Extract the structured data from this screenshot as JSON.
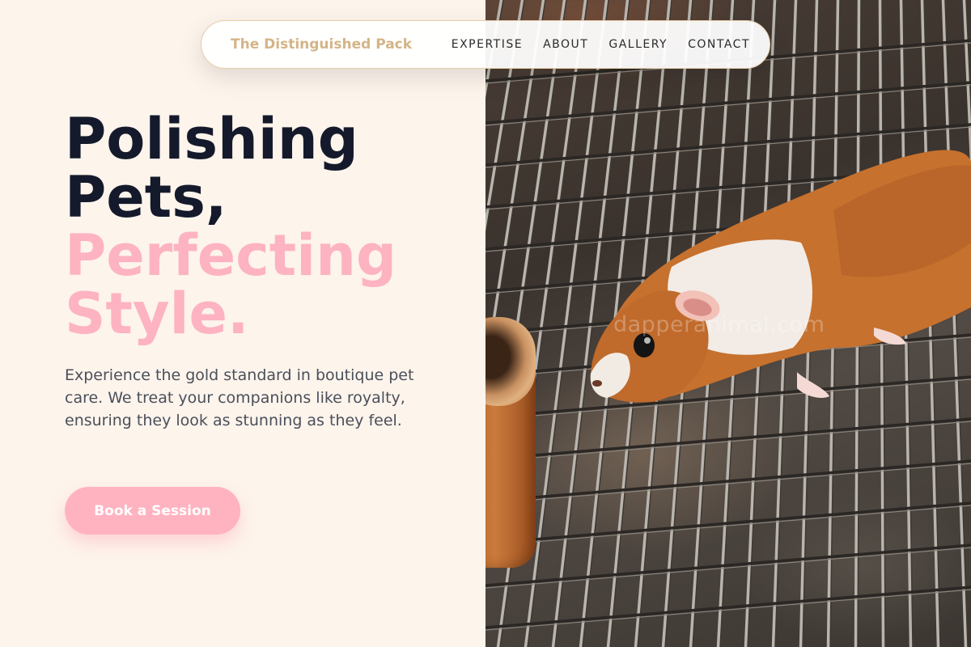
{
  "nav": {
    "brand": "The Distinguished Pack",
    "links": [
      "EXPERTISE",
      "ABOUT",
      "GALLERY",
      "CONTACT"
    ]
  },
  "hero": {
    "title_line1": "Polishing",
    "title_line2": "Pets,",
    "title_line3": "Perfecting",
    "title_line4": "Style.",
    "description": "Experience the gold standard in boutique pet care. We treat your companions like royalty, ensuring they look as stunning as they feel.",
    "cta_label": "Book a Session"
  },
  "photo": {
    "watermark": "dapperanimal.com",
    "subject": "guinea-pig-on-wire-cage"
  },
  "colors": {
    "background": "#fdf4ec",
    "brand": "#d4b487",
    "heading_dark": "#141a2b",
    "heading_pink": "#fdb3c1",
    "cta": "#ffb3c1"
  }
}
